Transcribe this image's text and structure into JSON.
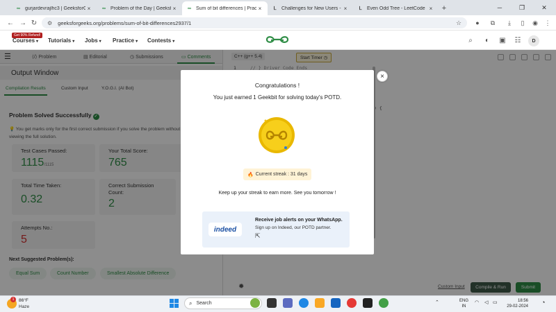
{
  "browser": {
    "tabs": [
      {
        "title": "gurjardevrajlhc3 | GeeksforGeeks",
        "icon": "gfg-favicon"
      },
      {
        "title": "Problem of the Day | GeeksforGeeks",
        "icon": "gfg-favicon"
      },
      {
        "title": "Sum of bit differences | Practice",
        "icon": "gfg-favicon",
        "active": true
      },
      {
        "title": "Challenges for New Users - LeetCode",
        "icon": "leetcode-favicon"
      },
      {
        "title": "Even Odd Tree - LeetCode",
        "icon": "leetcode-favicon"
      }
    ],
    "url": "geeksforgeeks.org/problems/sum-of-bit-differences2937/1"
  },
  "header": {
    "refund_badge": "Get 90% Refund!",
    "menu": [
      "Courses",
      "Tutorials",
      "Jobs",
      "Practice",
      "Contests"
    ],
    "avatar_initial": "D",
    "logo_color": "#2f8d46"
  },
  "problem_tabs": [
    "Problem",
    "Editorial",
    "Submissions",
    "Comments"
  ],
  "output": {
    "title": "Output Window",
    "subtabs": [
      "Compilation Results",
      "Custom Input",
      "Y.O.G.I. (AI Bot)"
    ],
    "status": "Problem Solved Successfully",
    "tip": "You get marks only for the first correct submission if you solve the problem without viewing the full solution.",
    "stats": {
      "test_cases_label": "Test Cases Passed:",
      "test_cases_value": "1115",
      "test_cases_total": "/1115",
      "score_label": "Your Total Score:",
      "score_value": "765",
      "time_label": "Total Time Taken:",
      "time_value": "0.32",
      "correct_label": "Correct Submission Count:",
      "correct_value": "2",
      "attempts_label": "Attempts No.:",
      "attempts_value": "5"
    },
    "next_suggested_label": "Next Suggested Problem(s):",
    "suggestions": [
      "Equal Sum",
      "Count Number",
      "Smallest Absolute Difference"
    ]
  },
  "editor": {
    "language": "C++ (g++ 5.4)",
    "timer_label": "Start Timer",
    "line1_number": "1",
    "line1_code": "// } Driver Code Ends",
    "brace_code": ") {",
    "custom_input_link": "Custom Input",
    "compile_run": "Compile & Run",
    "submit": "Submit"
  },
  "modal": {
    "congrats": "Congratulations !",
    "earned": "You just earned 1 Geekbit for solving today's POTD.",
    "streak": "Current streak : 31 days",
    "keep_up": "Keep up your streak to earn more. See you tomorrow !",
    "ad_logo": "indeed",
    "ad_title": "Receive job alerts on your WhatsApp.",
    "ad_subtitle": "Sign up on Indeed, our POTD partner."
  },
  "taskbar": {
    "weather_badge": "1",
    "temperature": "86°F",
    "condition": "Haze",
    "search_placeholder": "Search",
    "lang_top": "ENG",
    "lang_bottom": "IN",
    "time": "18:56",
    "date": "29-02-2024"
  }
}
